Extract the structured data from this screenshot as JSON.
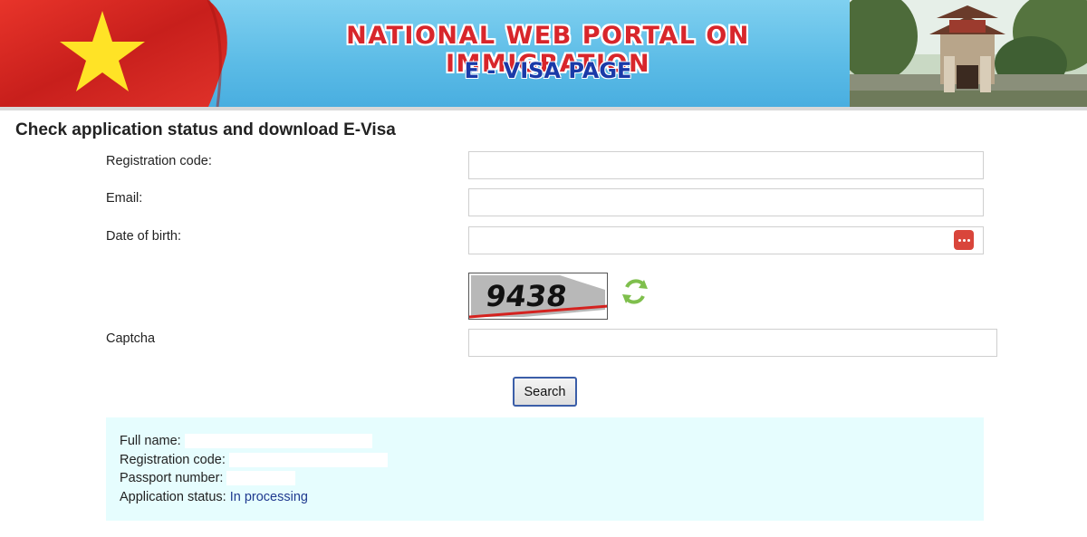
{
  "banner": {
    "title": "NATIONAL WEB PORTAL ON IMMIGRATION",
    "subtitle": "E - VISA PAGE",
    "colors": {
      "title": "#d8262b",
      "subtitle": "#1a3aa8",
      "flag_red": "#d92a24",
      "flag_star": "#ffe326"
    }
  },
  "page": {
    "title": "Check application status and download E-Visa"
  },
  "form": {
    "registration_code": {
      "label": "Registration code:",
      "value": ""
    },
    "email": {
      "label": "Email:",
      "value": ""
    },
    "date_of_birth": {
      "label": "Date of birth:",
      "value": "",
      "picker_icon": "calendar-icon"
    },
    "captcha": {
      "label": "Captcha",
      "image_text": "9438",
      "value": "",
      "refresh_icon": "refresh-icon"
    },
    "search_label": "Search"
  },
  "result": {
    "full_name_label": "Full name:",
    "registration_code_label": "Registration code:",
    "passport_number_label": "Passport number:",
    "status_label": "Application status:",
    "status_value": "In processing",
    "status_color": "#1f3a8f"
  }
}
